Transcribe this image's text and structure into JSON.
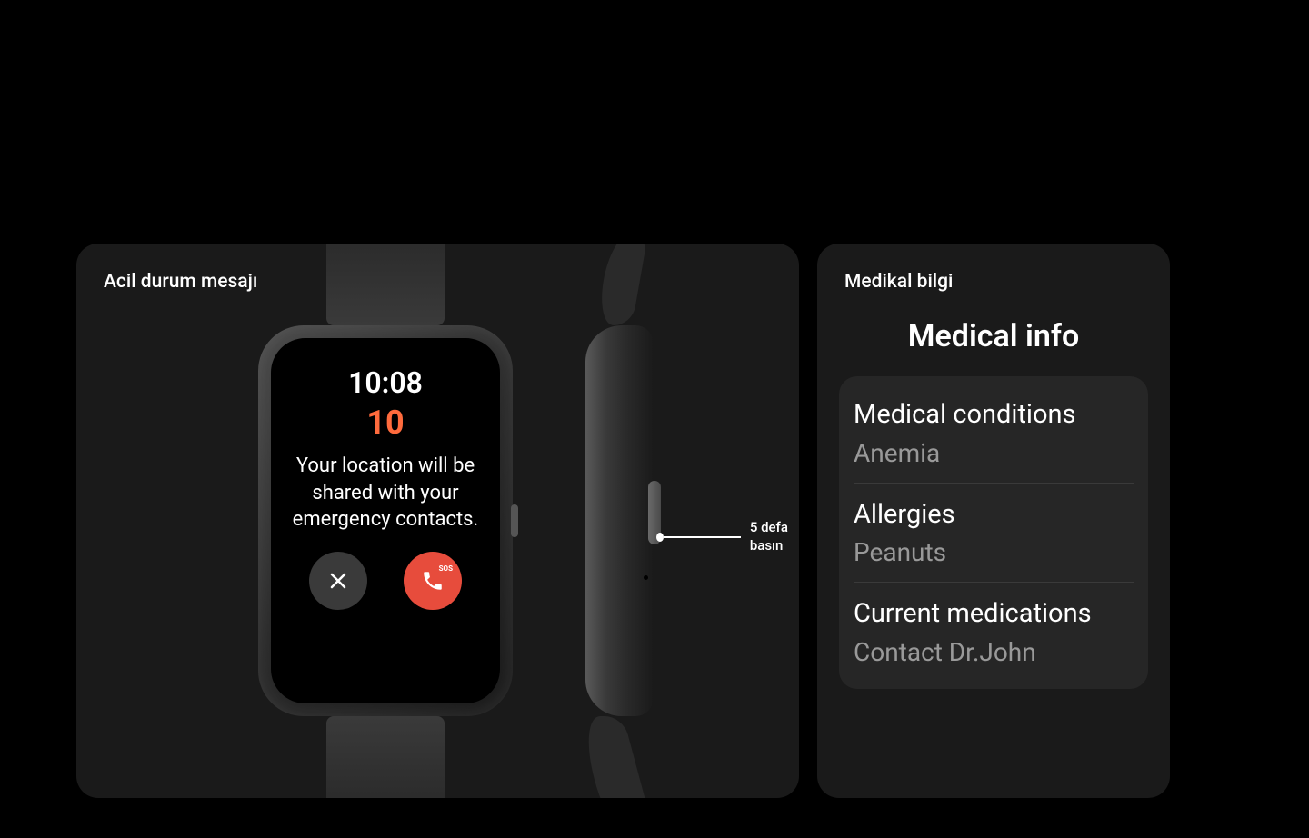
{
  "leftCard": {
    "title": "Acil durum mesajı",
    "watch": {
      "time": "10:08",
      "countdown": "10",
      "message": "Your location will be shared with your emergency contacts.",
      "sosLabel": "SOS"
    },
    "pointer": {
      "label": "5 defa basın"
    }
  },
  "rightCard": {
    "title": "Medikal bilgi",
    "screenTitle": "Medical info",
    "items": [
      {
        "label": "Medical conditions",
        "value": "Anemia"
      },
      {
        "label": "Allergies",
        "value": "Peanuts"
      },
      {
        "label": "Current medications",
        "value": "Contact Dr.John"
      }
    ]
  }
}
